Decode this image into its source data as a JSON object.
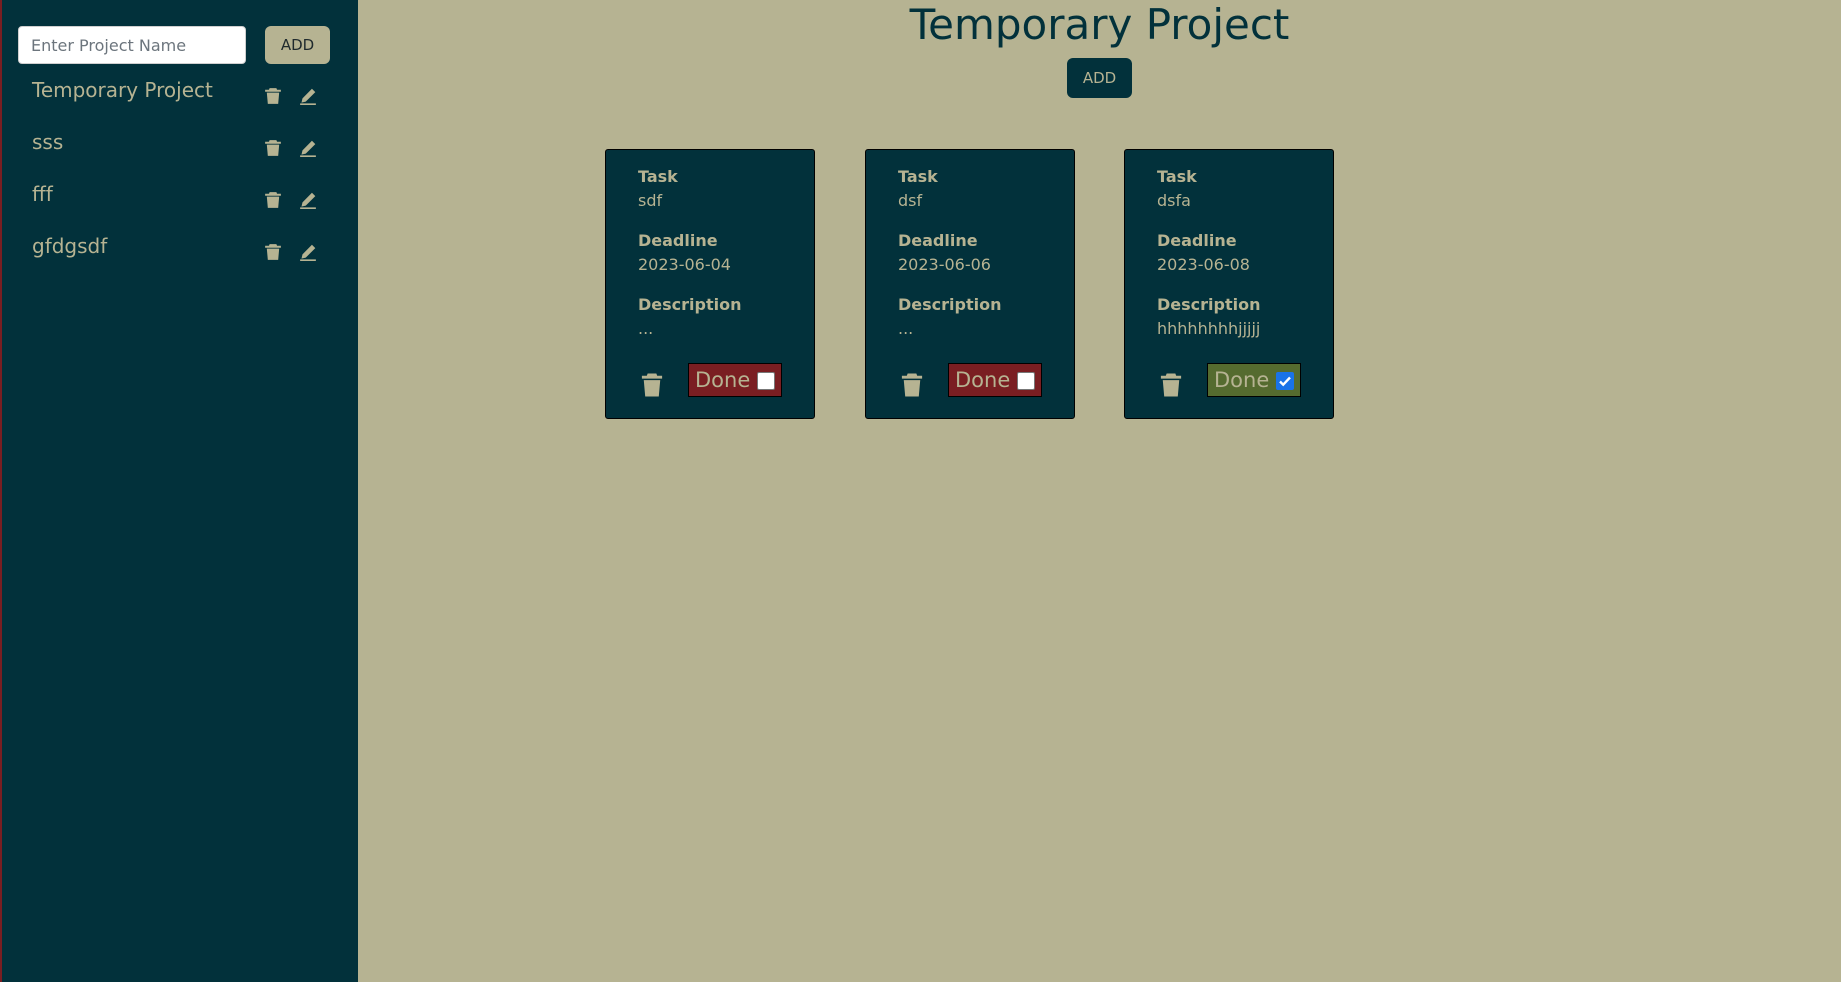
{
  "sidebar": {
    "input_placeholder": "Enter Project Name",
    "add_label": "ADD",
    "projects": [
      {
        "name": "Temporary Project"
      },
      {
        "name": "sss"
      },
      {
        "name": "fff"
      },
      {
        "name": "gfdgsdf"
      }
    ]
  },
  "main": {
    "title": "Temporary Project",
    "add_label": "ADD",
    "tasks": [
      {
        "task_label": "Task",
        "task": "sdf",
        "deadline_label": "Deadline",
        "deadline": "2023-06-04",
        "description_label": "Description",
        "description": "...",
        "done_label": "Done",
        "done": false
      },
      {
        "task_label": "Task",
        "task": "dsf",
        "deadline_label": "Deadline",
        "deadline": "2023-06-06",
        "description_label": "Description",
        "description": "...",
        "done_label": "Done",
        "done": false
      },
      {
        "task_label": "Task",
        "task": "dsfa",
        "deadline_label": "Deadline",
        "deadline": "2023-06-08",
        "description_label": "Description",
        "description": "hhhhhhhhjjjjj",
        "done_label": "Done",
        "done": true
      }
    ]
  },
  "colors": {
    "sidebar_bg": "#02313b",
    "page_bg": "#b6b392",
    "done_pending": "#7a1e22",
    "done_complete": "#556b2f"
  },
  "icons": [
    "trash-icon",
    "pencil-icon",
    "checkmark-icon"
  ]
}
